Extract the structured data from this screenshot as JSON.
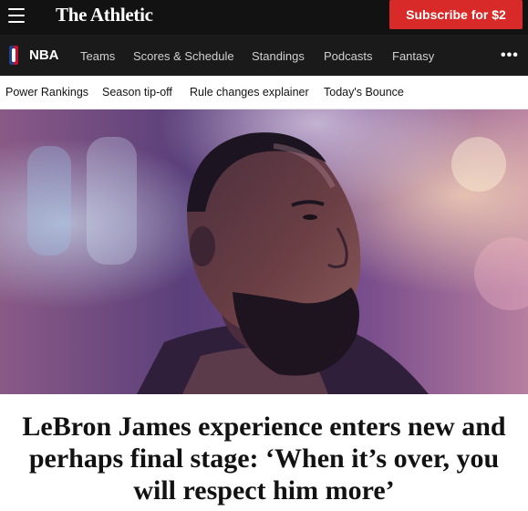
{
  "header": {
    "brand": "The Athletic",
    "subscribe_label": "Subscribe for $2"
  },
  "league_nav": {
    "title": "NBA",
    "items": [
      {
        "label": "Teams"
      },
      {
        "label": "Scores & Schedule"
      },
      {
        "label": "Standings"
      },
      {
        "label": "Podcasts"
      },
      {
        "label": "Fantasy"
      }
    ],
    "more_label": "•••"
  },
  "sub_nav": {
    "items": [
      {
        "label": "Power Rankings"
      },
      {
        "label": "Season tip-off"
      },
      {
        "label": "Rule changes explainer"
      },
      {
        "label": "Today's Bounce"
      }
    ]
  },
  "article": {
    "headline": "LeBron James experience enters new and perhaps final stage: ‘When it’s over, you will respect him more’"
  },
  "colors": {
    "topbar": "#121212",
    "subscribe": "#d82a28",
    "navbar": "#1a1a1a"
  },
  "icons": [
    "menu-icon",
    "nba-logo-icon",
    "more-icon"
  ]
}
